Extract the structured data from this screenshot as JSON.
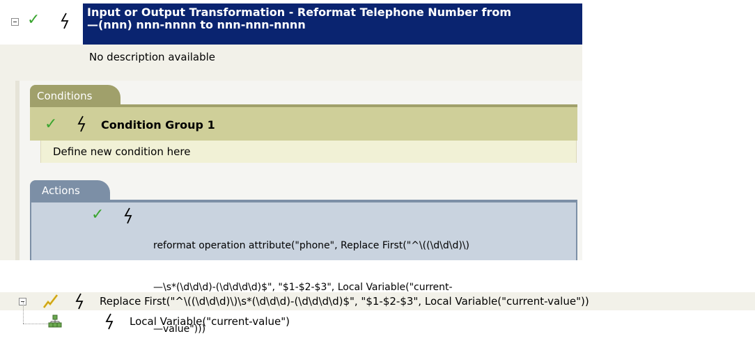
{
  "rule": {
    "title_line1": "Input or Output Transformation - Reformat Telephone Number from",
    "title_line2": "—(nnn) nnn-nnnn to nnn-nnn-nnnn",
    "description": "No description available"
  },
  "conditions": {
    "tab_label": "Conditions",
    "group_label": "Condition Group 1",
    "placeholder": "Define new condition here"
  },
  "actions": {
    "tab_label": "Actions",
    "action_line1": "reformat operation attribute(\"phone\", Replace First(\"^\\((\\d\\d\\d)\\)",
    "action_line2": "—\\s*(\\d\\d\\d)-(\\d\\d\\d\\d)$\", \"$1-$2-$3\", Local Variable(\"current-",
    "action_line3": "—value\")))"
  },
  "expression_tree": {
    "root_text": "Replace First(\"^\\((\\d\\d\\d)\\)\\s*(\\d\\d\\d)-(\\d\\d\\d\\d)$\", \"$1-$2-$3\", Local Variable(\"current-value\"))",
    "child_text": "Local Variable(\"current-value\")"
  },
  "icons": {
    "check": "check-icon",
    "bolt": "lightning-icon",
    "collapse": "collapse-icon",
    "tree_node": "tree-node-icon",
    "pencil": "pencil-icon"
  },
  "colors": {
    "title_bg": "#0a2470",
    "conditions_accent": "#a0a06b",
    "actions_accent": "#7c8fa6",
    "check_green": "#3aa52f"
  }
}
